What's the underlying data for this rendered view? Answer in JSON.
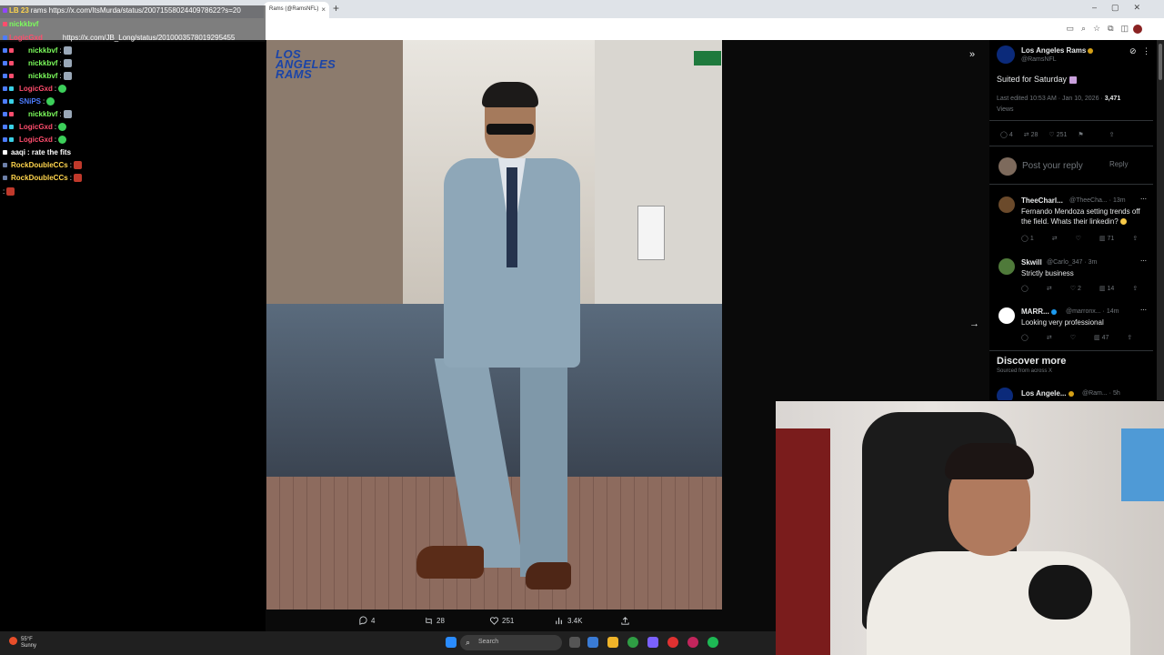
{
  "browser": {
    "tab_title": "Rams (@RamsNFL)",
    "close_glyph": "×",
    "new_tab_glyph": "+"
  },
  "chat": {
    "top_lines": [
      {
        "user": "LB 23",
        "text": "rams https://x.com/ItsMurda/status/2007155802440978622?s=20"
      },
      {
        "user": "nickkbvf",
        "text": ""
      },
      {
        "user": "LogicGxd",
        "text": "https://x.com/JB_Long/status/2010003578019295455"
      }
    ],
    "lines": [
      {
        "user": "nickkbvf",
        "text": ":",
        "color": "#7cfc5c"
      },
      {
        "user": "nickkbvf",
        "text": ":",
        "color": "#7cfc5c"
      },
      {
        "user": "nickkbvf",
        "text": ":",
        "color": "#7cfc5c"
      },
      {
        "user": "LogicGxd",
        "text": ":",
        "color": "#ff4d6d"
      },
      {
        "user": "SNiPS",
        "text": ":",
        "color": "#4d7cff"
      },
      {
        "user": "nickkbvf",
        "text": ":",
        "color": "#7cfc5c"
      },
      {
        "user": "LogicGxd",
        "text": ":",
        "color": "#ff4d6d"
      },
      {
        "user": "LogicGxd",
        "text": ":",
        "color": "#ff4d6d"
      },
      {
        "user": "aaqi",
        "text": ": rate the fits",
        "color": "#ffffff"
      },
      {
        "user": "RockDoubleCCs",
        "text": ":",
        "color": "#ffd54d"
      },
      {
        "user": "RockDoubleCCs",
        "text": ":",
        "color": "#ffd54d"
      },
      {
        "user": "",
        "text": ":",
        "color": "#ffffff"
      }
    ]
  },
  "media": {
    "logo_lines": [
      "LOS",
      "ANGELES",
      "RAMS"
    ],
    "stats": {
      "replies": "4",
      "reposts": "28",
      "likes": "251",
      "views": "3.4K"
    }
  },
  "tweet": {
    "author": "Los Angeles Rams",
    "handle": "@RamsNFL",
    "text": "Suited for Saturday",
    "meta": "Last edited 10:53 AM · Jan 10, 2026 ·",
    "views_count": "3,471",
    "views_label": "Views",
    "replies": "4",
    "reposts": "28",
    "likes": "251",
    "reply_placeholder": "Post your reply",
    "reply_button": "Reply",
    "replies_list": [
      {
        "name": "TheeCharl...",
        "handle": "@TheeCha... · 13m",
        "text1": "Fernando Mendoza setting trends off",
        "text2": "the field. Whats their linkedin?",
        "replies": "1",
        "likes": "",
        "views": "71",
        "color": "#6b4a2b"
      },
      {
        "name": "Skwill",
        "handle": "@Carlo_347 · 3m",
        "text1": "Strictly business",
        "text2": "",
        "replies": "",
        "likes": "2",
        "views": "14",
        "color": "#4f7a3a"
      },
      {
        "name": "MARR...",
        "handle": "@marronx... · 14m",
        "text1": "Looking very professional",
        "text2": "",
        "replies": "",
        "likes": "",
        "views": "47",
        "color": "#ffffff"
      }
    ],
    "discover_title": "Discover more",
    "discover_sub": "Sourced from across X",
    "discover_item_name": "Los Angele...",
    "discover_item_handle": "@Ram... · 5h"
  },
  "taskbar": {
    "temp": "55°F",
    "condition": "Sunny",
    "search_placeholder": "Search"
  },
  "colors": {
    "accent_blue": "#1d9bf0",
    "rams_blue": "#1a44a8",
    "panel_bg": "#000000",
    "muted": "#71767b"
  }
}
